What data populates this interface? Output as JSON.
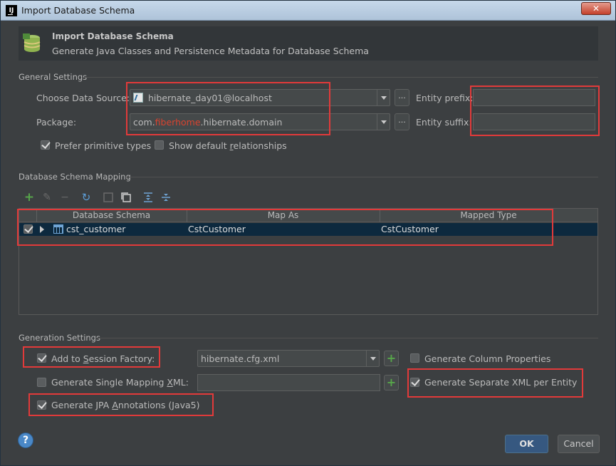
{
  "window": {
    "title": "Import Database Schema",
    "app_icon_label": "IJ",
    "close_glyph": "✕"
  },
  "header": {
    "title": "Import Database Schema",
    "subtitle": "Generate Java Classes and Persistence Metadata for Database Schema",
    "icon": "database-schema-icon"
  },
  "general": {
    "section_title": "General Settings",
    "data_source_label": "Choose Data Source:",
    "data_source_value": "hibernate_day01@localhost",
    "package_label": "Package:",
    "package_prefix": "com.",
    "package_highlight": "fiberhome",
    "package_suffix": ".hibernate.domain",
    "browse_glyph": "...",
    "entity_prefix_label": "Entity prefix:",
    "entity_prefix_value": "",
    "entity_suffix_label": "Entity suffix:",
    "entity_suffix_value": "",
    "prefer_primitive_label": "Prefer primitive types",
    "prefer_primitive_checked": true,
    "show_default_pre": "Show default ",
    "show_default_mn": "r",
    "show_default_post": "elationships",
    "show_default_checked": false
  },
  "mapping": {
    "section_title": "Database Schema Mapping",
    "toolbar": [
      "add-icon",
      "edit-icon",
      "remove-icon",
      "refresh-icon",
      "unselect-all-icon",
      "select-all-icon",
      "expand-all-icon",
      "collapse-all-icon"
    ],
    "columns": [
      "Database Schema",
      "Map As",
      "Mapped Type"
    ],
    "rows": [
      {
        "checked": true,
        "schema": "cst_customer",
        "map_as": "CstCustomer",
        "mapped_type": "CstCustomer"
      }
    ]
  },
  "generation": {
    "section_title": "Generation Settings",
    "add_session_pre": "Add to ",
    "add_session_mn": "S",
    "add_session_post": "ession Factory:",
    "add_session_checked": true,
    "session_factory_value": "hibernate.cfg.xml",
    "single_mapping_pre": "Generate Single Mapping ",
    "single_mapping_mn": "X",
    "single_mapping_post": "ML:",
    "single_mapping_checked": false,
    "single_mapping_value": "",
    "jpa_pre": "Generate JPA ",
    "jpa_mn": "A",
    "jpa_post": "nnotations (Java5)",
    "jpa_checked": true,
    "column_props_label": "Generate Column Properties",
    "column_props_checked": false,
    "separate_xml_label": "Generate Separate XML per Entity",
    "separate_xml_checked": true,
    "plus_glyph": "+"
  },
  "footer": {
    "help_glyph": "?",
    "ok_label": "OK",
    "cancel_label": "Cancel"
  },
  "colors": {
    "background": "#3c3f41",
    "highlight_text": "#d9432f",
    "selected_row": "#0d293e",
    "annotation_box": "#e23a3a",
    "add_green": "#57a64a"
  }
}
